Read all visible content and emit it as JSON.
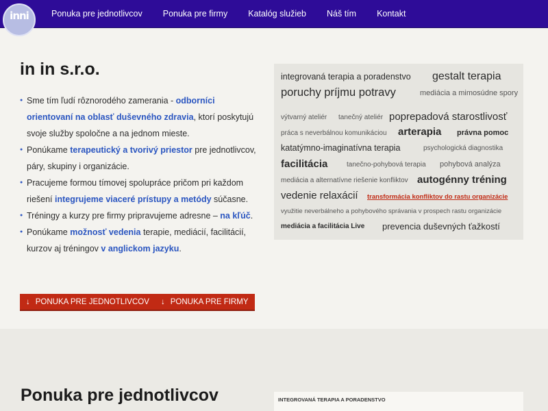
{
  "logo": {
    "text": "inni"
  },
  "nav": [
    "Ponuka pre jednotlivcov",
    "Ponuka pre firmy",
    "Katalóg služieb",
    "Náš tím",
    "Kontakt"
  ],
  "company": "in in s.r.o.",
  "bullets": [
    {
      "parts": [
        {
          "t": "Sme tím ľudí rôznorodého zamerania - ",
          "b": false
        },
        {
          "t": "odborníci orientovaní na oblasť duševného zdravia",
          "b": true
        },
        {
          "t": ", ktorí poskytujú svoje služby spoločne a na jednom mieste.",
          "b": false
        }
      ]
    },
    {
      "parts": [
        {
          "t": "Ponúkame ",
          "b": false
        },
        {
          "t": "terapeutický a tvorivý priestor",
          "b": true
        },
        {
          "t": " pre jednotlivcov, páry, skupiny i organizácie.",
          "b": false
        }
      ]
    },
    {
      "parts": [
        {
          "t": "Pracujeme formou tímovej spolupráce pričom pri každom riešení ",
          "b": false
        },
        {
          "t": "integrujeme viaceré prístupy a metódy",
          "b": true
        },
        {
          "t": " súčasne.",
          "b": false
        }
      ]
    },
    {
      "parts": [
        {
          "t": "Tréningy a kurzy pre firmy pripravujeme adresne – ",
          "b": false
        },
        {
          "t": "na kľúč",
          "b": true
        },
        {
          "t": ".",
          "b": false
        }
      ]
    },
    {
      "parts": [
        {
          "t": "Ponúkame ",
          "b": false
        },
        {
          "t": "možnosť vedenia",
          "b": true
        },
        {
          "t": " terapie, mediácií, facilitácií, kurzov aj tréningov ",
          "b": false
        },
        {
          "t": "v anglickom jazyku",
          "b": true
        },
        {
          "t": ".",
          "b": false
        }
      ]
    }
  ],
  "buttons": {
    "arrow": "↓",
    "individuals": "Ponuka pre jednotlivcov",
    "companies": "Ponuka pre firmy"
  },
  "tags": [
    "integrovaná terapia a poradenstvo",
    "gestalt terapia",
    "poruchy príjmu potravy",
    "mediácia a mimosúdne spory",
    "výtvarný ateliér",
    "tanečný ateliér",
    "poprepadová starostlivosť",
    "práca s neverbálnou komunikáciou",
    "arterapia",
    "právna pomoc",
    "katatýmno-imaginatívna terapia",
    "psychologická diagnostika",
    "facilitácia",
    "tanečno-pohybová terapia",
    "pohybová analýza",
    "mediácia a alternatívne riešenie konfliktov",
    "autogénny tréning",
    "vedenie relaxácií",
    "transformácia konfliktov do rastu organizácie",
    "využitie neverbálneho a pohybového správania v prospech rastu organizácie",
    "mediácia a facilitácia Live",
    "prevencia duševných ťažkostí"
  ],
  "lower": {
    "title": "Ponuka pre jednotlivcov",
    "box_label": "integrovaná terapia a poradenstvo"
  },
  "colors": {
    "nav": "#2e0c98",
    "accent": "#2a55c0",
    "button": "#c12a14"
  }
}
